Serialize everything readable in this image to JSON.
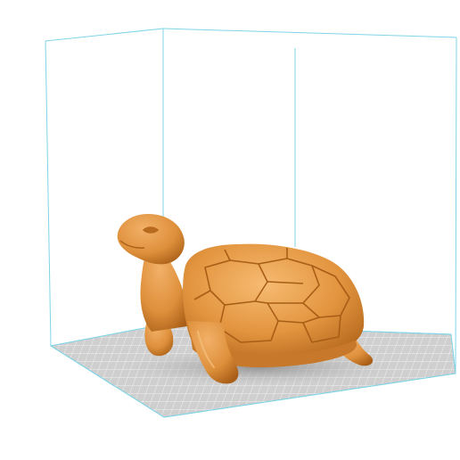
{
  "viewport": {
    "background_color": "#ffffff",
    "build_volume_outline_color": "#7fd4e6",
    "build_plate_color": "#d2d2d2",
    "build_plate_grid_color": "#ffffff",
    "model_color": "#e3953f",
    "model_shade_color": "#b86a1e",
    "model_highlight_color": "#f4b46a",
    "model_shadow_color": "#9a9a9a",
    "model_name": "turtle-model"
  }
}
